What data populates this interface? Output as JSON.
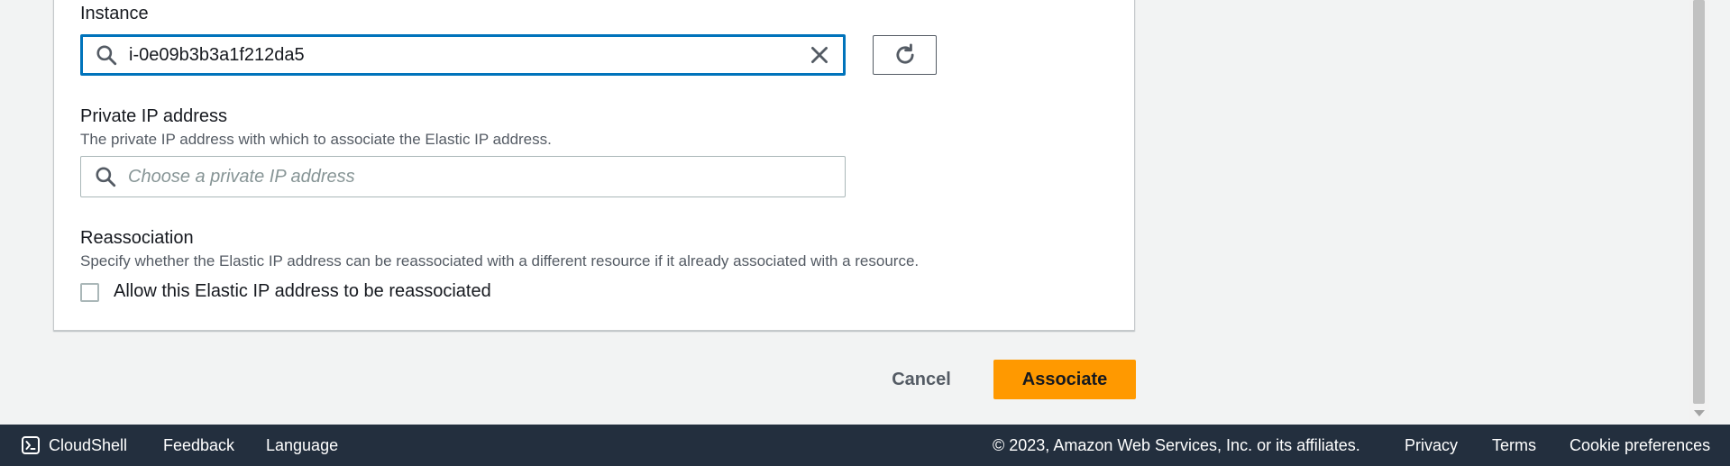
{
  "instance": {
    "label": "Instance",
    "value": "i-0e09b3b3a1f212da5",
    "icons": {
      "search": "search-icon",
      "clear": "close-icon",
      "refresh": "refresh-icon"
    }
  },
  "private_ip": {
    "label": "Private IP address",
    "description": "The private IP address with which to associate the Elastic IP address.",
    "placeholder": "Choose a private IP address"
  },
  "reassociation": {
    "label": "Reassociation",
    "description": "Specify whether the Elastic IP address can be reassociated with a different resource if it already associated with a resource.",
    "checkbox_label": "Allow this Elastic IP address to be reassociated",
    "checked": false
  },
  "actions": {
    "cancel": "Cancel",
    "associate": "Associate"
  },
  "footer": {
    "cloudshell": "CloudShell",
    "feedback": "Feedback",
    "language": "Language",
    "copyright": "© 2023, Amazon Web Services, Inc. or its affiliates.",
    "privacy": "Privacy",
    "terms": "Terms",
    "cookie_preferences": "Cookie preferences"
  },
  "colors": {
    "accent_blue": "#0073bb",
    "primary_button": "#ff9900",
    "footer_bg": "#232f3e",
    "page_bg": "#f2f3f3"
  }
}
